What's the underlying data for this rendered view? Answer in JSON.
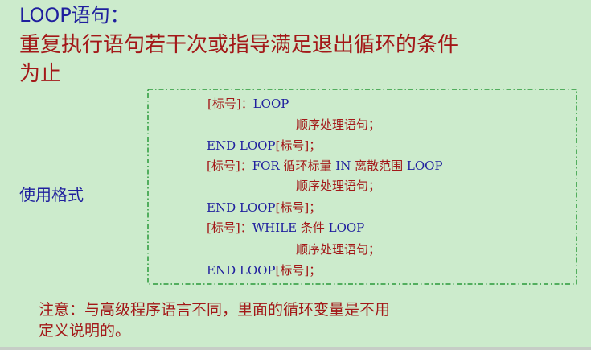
{
  "title": "LOOP语句：",
  "description": {
    "line1": "重复执行语句若干次或指导满足退出循环的条件",
    "line2": "为止"
  },
  "usage_label": "使用格式",
  "code": {
    "l1_label": "[标号]：",
    "l1_kw": "LOOP",
    "l2": "顺序处理语句；",
    "l3_kw": "END LOOP",
    "l3_label": "[标号]；",
    "l4_label": "[标号]：",
    "l4_kw1": "FOR ",
    "l4_mid1": "循环标量 ",
    "l4_kw2": "IN ",
    "l4_mid2": "离散范围 ",
    "l4_kw3": "LOOP",
    "l5": "顺序处理语句；",
    "l6_kw": "END LOOP",
    "l6_label": "[标号]；",
    "l7_label": "[标号]：",
    "l7_kw1": "WHILE ",
    "l7_mid": "条件 ",
    "l7_kw2": "LOOP",
    "l8": "顺序处理语句；",
    "l9_kw": "END LOOP",
    "l9_label": "[标号]；"
  },
  "note": {
    "line1": "注意：与高级程序语言不同，里面的循环变量是不用",
    "line2": "定义说明的。"
  },
  "colors": {
    "background": "#ccebcc",
    "blue_text": "#1f1f9e",
    "red_text": "#a31818",
    "box_border": "#2a9a3a"
  }
}
